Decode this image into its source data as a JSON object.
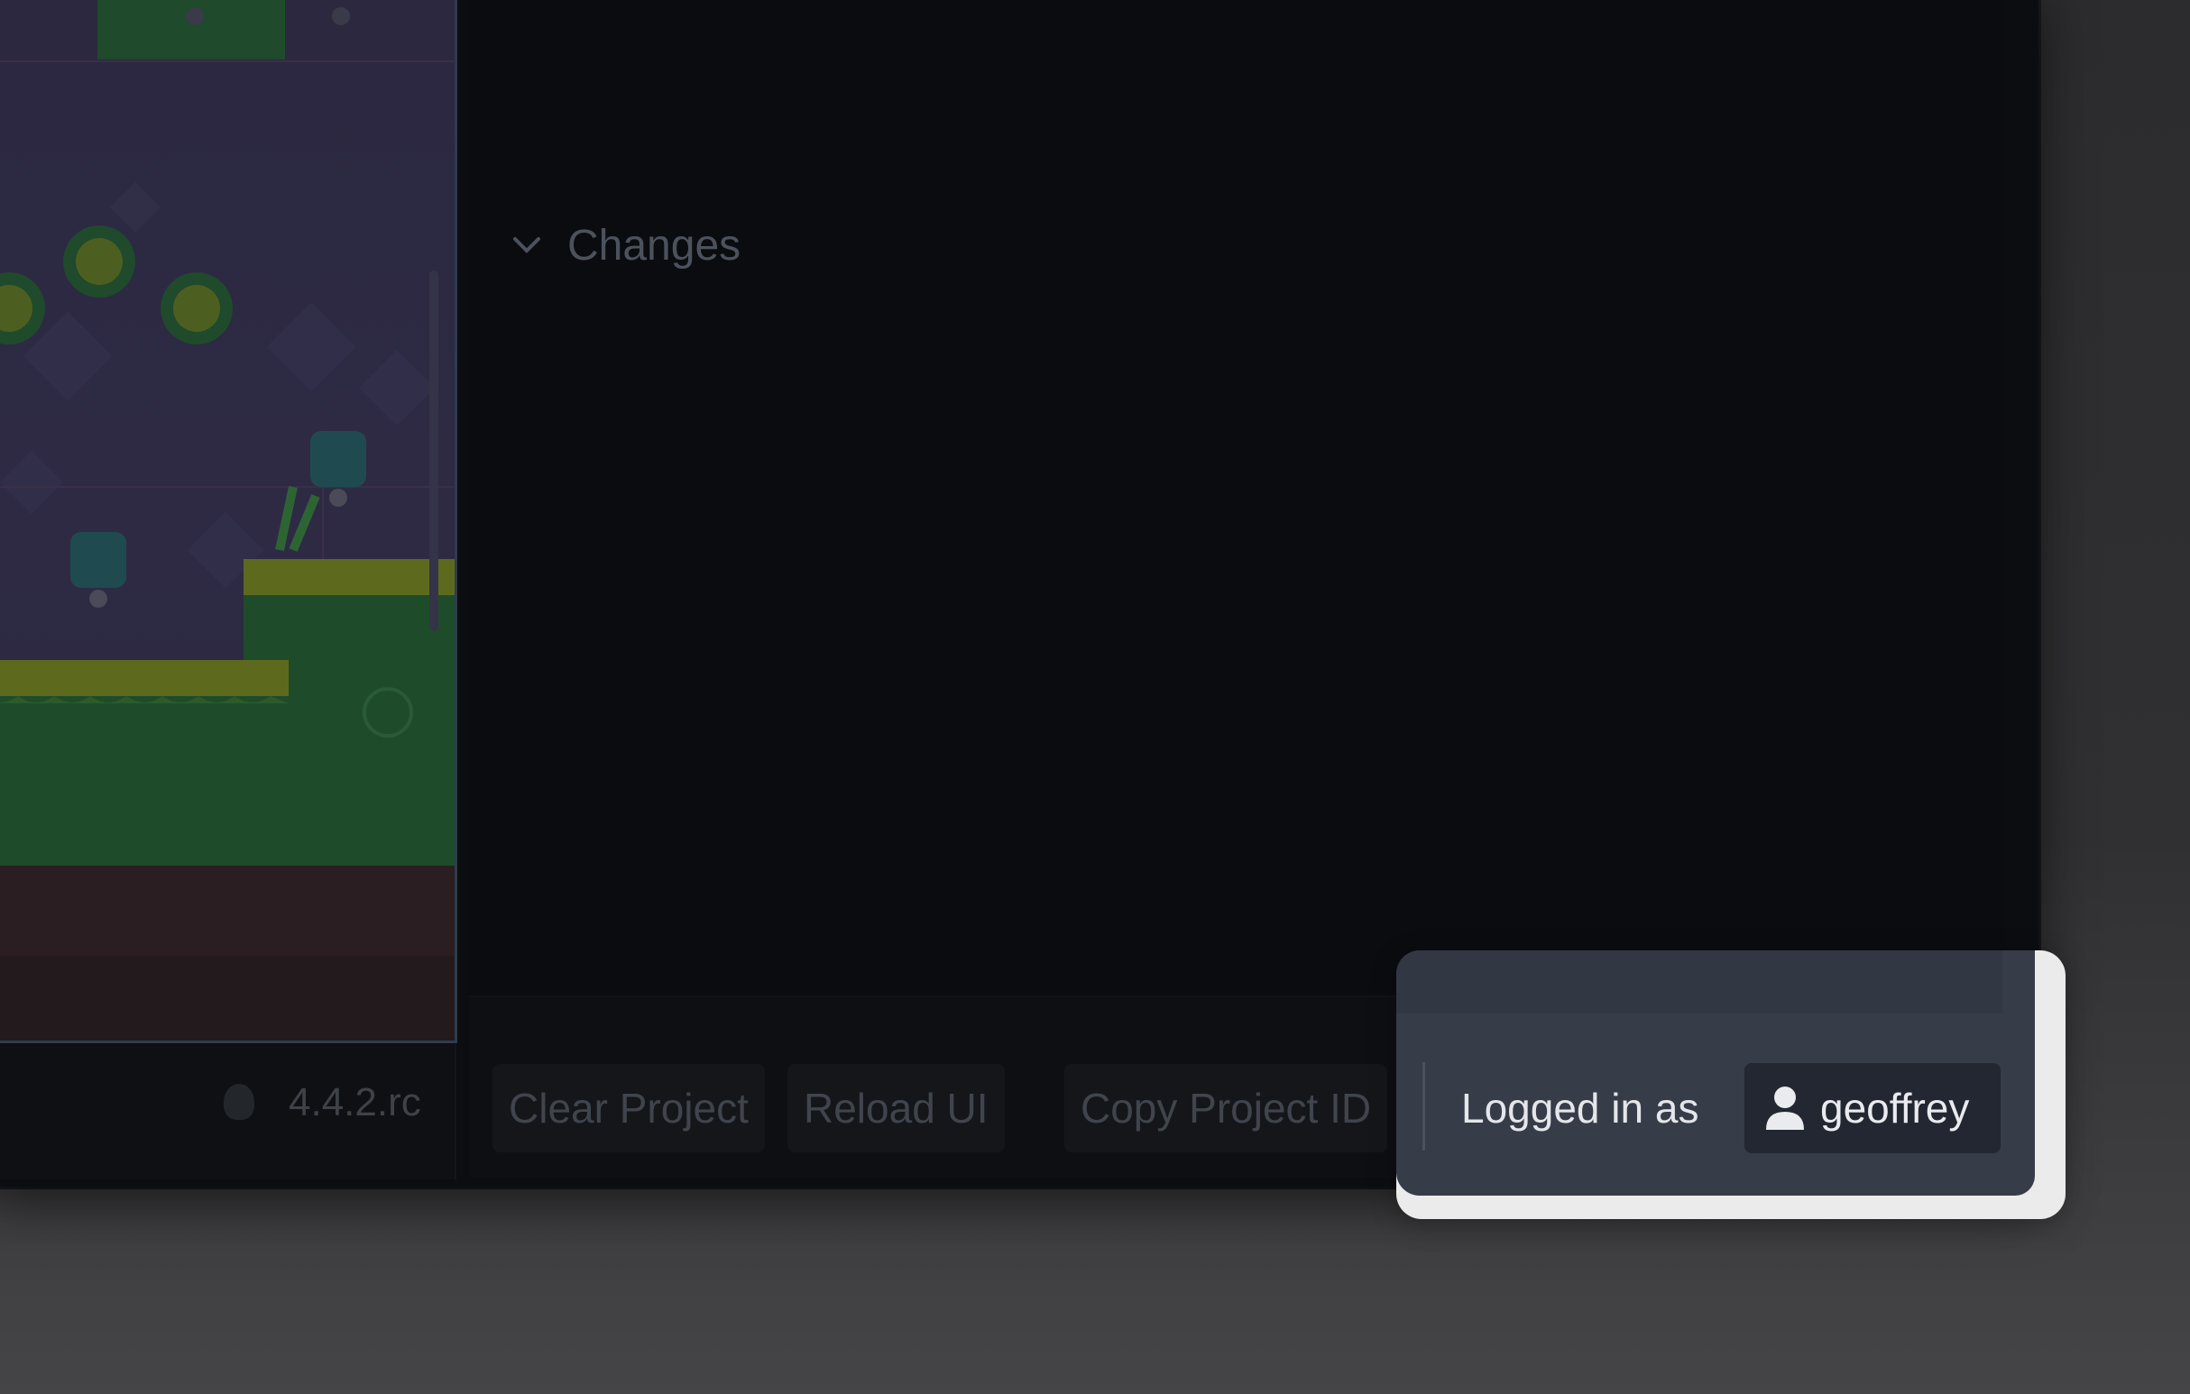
{
  "editor": {
    "version": "4.4.2.rc",
    "changes_section": {
      "label": "Changes",
      "icon": "chevron-down-icon"
    }
  },
  "toolbar": {
    "clear_project": "Clear Project",
    "reload_ui": "Reload UI",
    "copy_project_id": "Copy Project ID"
  },
  "account": {
    "logged_in_label": "Logged in as",
    "username": "geoffrey",
    "icon": "user-icon"
  },
  "colors": {
    "highlight_panel": "#363c48",
    "highlight_border": "#ebebeb",
    "user_chip": "#222731",
    "background": "#0b0c0f"
  }
}
